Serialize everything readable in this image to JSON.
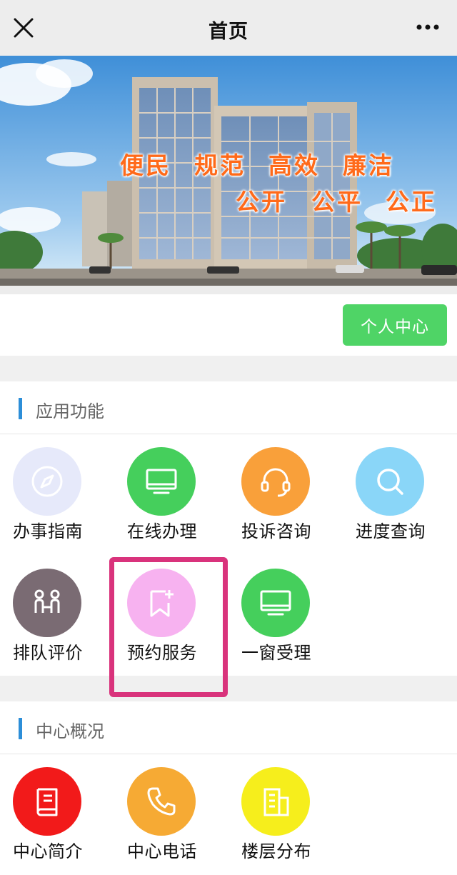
{
  "header": {
    "title": "首页"
  },
  "banner": {
    "slogans": [
      "便民",
      "规范",
      "高效",
      "廉洁",
      "公开",
      "公平",
      "公正"
    ],
    "slogan_color": "#ff6a1a"
  },
  "personal_center_button": {
    "label": "个人中心",
    "color": "#4fd466"
  },
  "sections": [
    {
      "title": "应用功能",
      "items": [
        {
          "label": "办事指南",
          "icon": "compass-icon",
          "color": "#e6e9fa"
        },
        {
          "label": "在线办理",
          "icon": "monitor-icon",
          "color": "#45cf5c"
        },
        {
          "label": "投诉咨询",
          "icon": "headset-icon",
          "color": "#f9a03a"
        },
        {
          "label": "进度查询",
          "icon": "search-icon",
          "color": "#8ad6f8"
        },
        {
          "label": "排队评价",
          "icon": "people-icon",
          "color": "#7a6b73"
        },
        {
          "label": "预约服务",
          "icon": "bookmark-add-icon",
          "color": "#f7b2f0"
        },
        {
          "label": "一窗受理",
          "icon": "monitor-icon",
          "color": "#45cf5c"
        }
      ]
    },
    {
      "title": "中心概况",
      "items": [
        {
          "label": "中心简介",
          "icon": "book-icon",
          "color": "#f21a1a"
        },
        {
          "label": "中心电话",
          "icon": "phone-icon",
          "color": "#f6aa34"
        },
        {
          "label": "楼层分布",
          "icon": "building-icon",
          "color": "#f6ee1c"
        }
      ]
    }
  ],
  "highlight_color": "#d9337c"
}
